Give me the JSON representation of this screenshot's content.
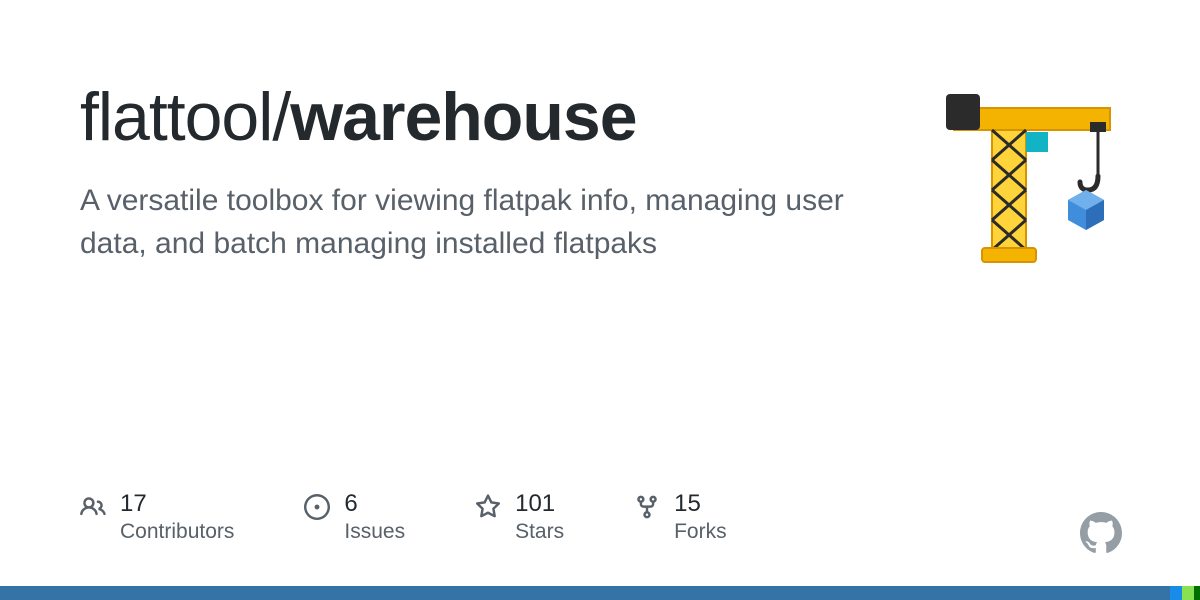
{
  "repo": {
    "owner": "flattool",
    "separator": "/",
    "name": "warehouse",
    "description": "A versatile toolbox for viewing flatpak info, managing user data, and batch managing installed flatpaks"
  },
  "stats": {
    "contributors": {
      "count": "17",
      "label": "Contributors"
    },
    "issues": {
      "count": "6",
      "label": "Issues"
    },
    "stars": {
      "count": "101",
      "label": "Stars"
    },
    "forks": {
      "count": "15",
      "label": "Forks"
    }
  },
  "languages": [
    {
      "color": "#3572A5",
      "percent": 97.5
    },
    {
      "color": "#198CE7",
      "percent": 1.0
    },
    {
      "color": "#89e051",
      "percent": 1.0
    },
    {
      "color": "#007100",
      "percent": 0.5
    }
  ]
}
